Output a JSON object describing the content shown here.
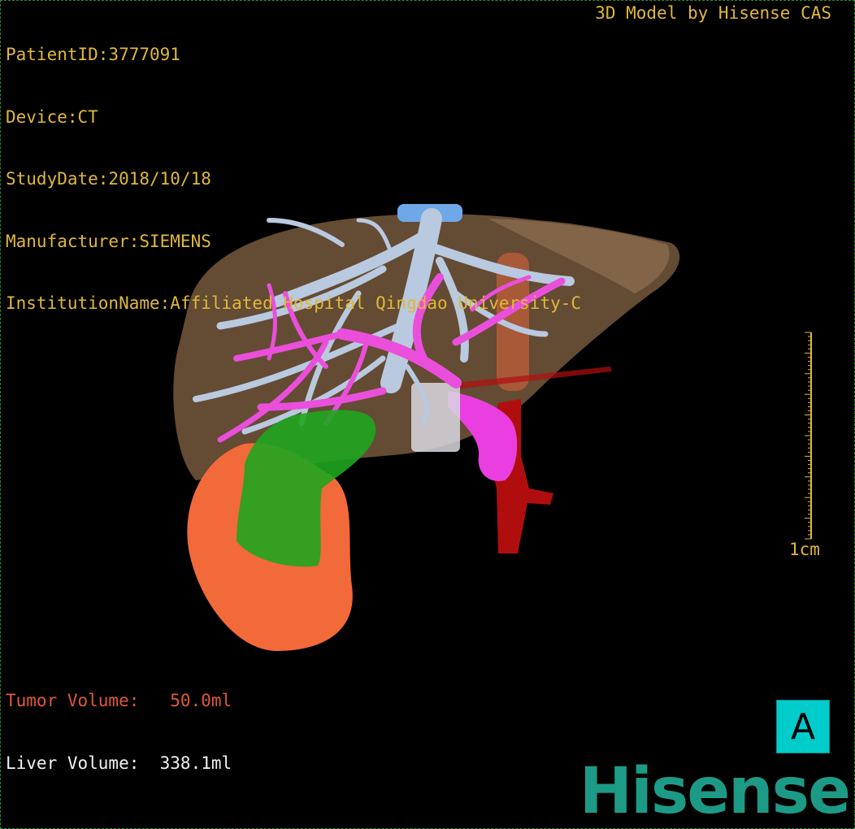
{
  "patient_info": {
    "lines": [
      "PatientID:3777091",
      "Device:CT",
      "StudyDate:2018/10/18",
      "Manufacturer:SIEMENS",
      "InstitutionName:Affiliated Hospital Qingdao University-C"
    ]
  },
  "model_credit": "3D Model by Hisense CAS",
  "volumes": {
    "tumor": "Tumor Volume:   50.0ml",
    "liver": "Liver Volume:  338.1ml"
  },
  "scale": {
    "label": "1cm"
  },
  "orientation": {
    "label": "A"
  },
  "brand": {
    "logo": "Hisense"
  },
  "colors": {
    "overlay_text": "#e0b83a",
    "tumor_text": "#e0573c",
    "liver": "#8a6a4a",
    "hepatic_vein": "#b8c8e0",
    "portal_vein": "#e84fd8",
    "artery": "#c01010",
    "tumor": "#f06a3a",
    "gallbladder": "#1ea01e",
    "cube": "#00cccc",
    "brand": "#1d9a86"
  }
}
